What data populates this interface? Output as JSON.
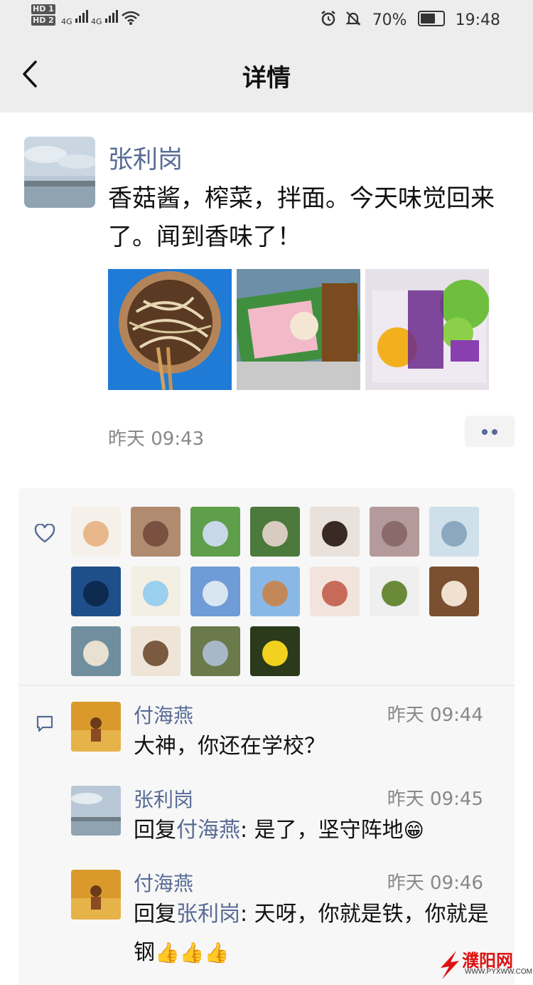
{
  "status_bar": {
    "sim1": "HD 1",
    "sim2": "HD 2",
    "network1": "4G",
    "network2": "4G",
    "battery": "70%",
    "time": "19:48"
  },
  "header": {
    "title": "详情"
  },
  "post": {
    "author": "张利岗",
    "text": "香菇酱，榨菜，拌面。今天味觉回来了。闻到香味了！",
    "time": "昨天 09:43",
    "images": [
      "noodles-photo",
      "pickle-bag-photo",
      "pickle-bag-2-photo"
    ]
  },
  "likes": {
    "avatar_count": 18
  },
  "comments": [
    {
      "name": "付海燕",
      "time": "昨天 09:44",
      "text": "大神，你还在学校？",
      "reply_prefix": "",
      "reply_to": "",
      "emoji": ""
    },
    {
      "name": "张利岗",
      "time": "昨天 09:45",
      "reply_prefix": "回复",
      "reply_to": "付海燕",
      "text": ": 是了，坚守阵地",
      "emoji": "😁"
    },
    {
      "name": "付海燕",
      "time": "昨天 09:46",
      "reply_prefix": "回复",
      "reply_to": "张利岗",
      "text": ": 天呀，你就是铁，你就是钢",
      "emoji": "👍👍👍"
    }
  ],
  "watermark": {
    "title": "濮阳网",
    "url": "WWW.PYXWW.COM"
  },
  "colors": {
    "link": "#576b95",
    "bar_bg": "#ededed",
    "panel_bg": "#f7f7f7"
  }
}
